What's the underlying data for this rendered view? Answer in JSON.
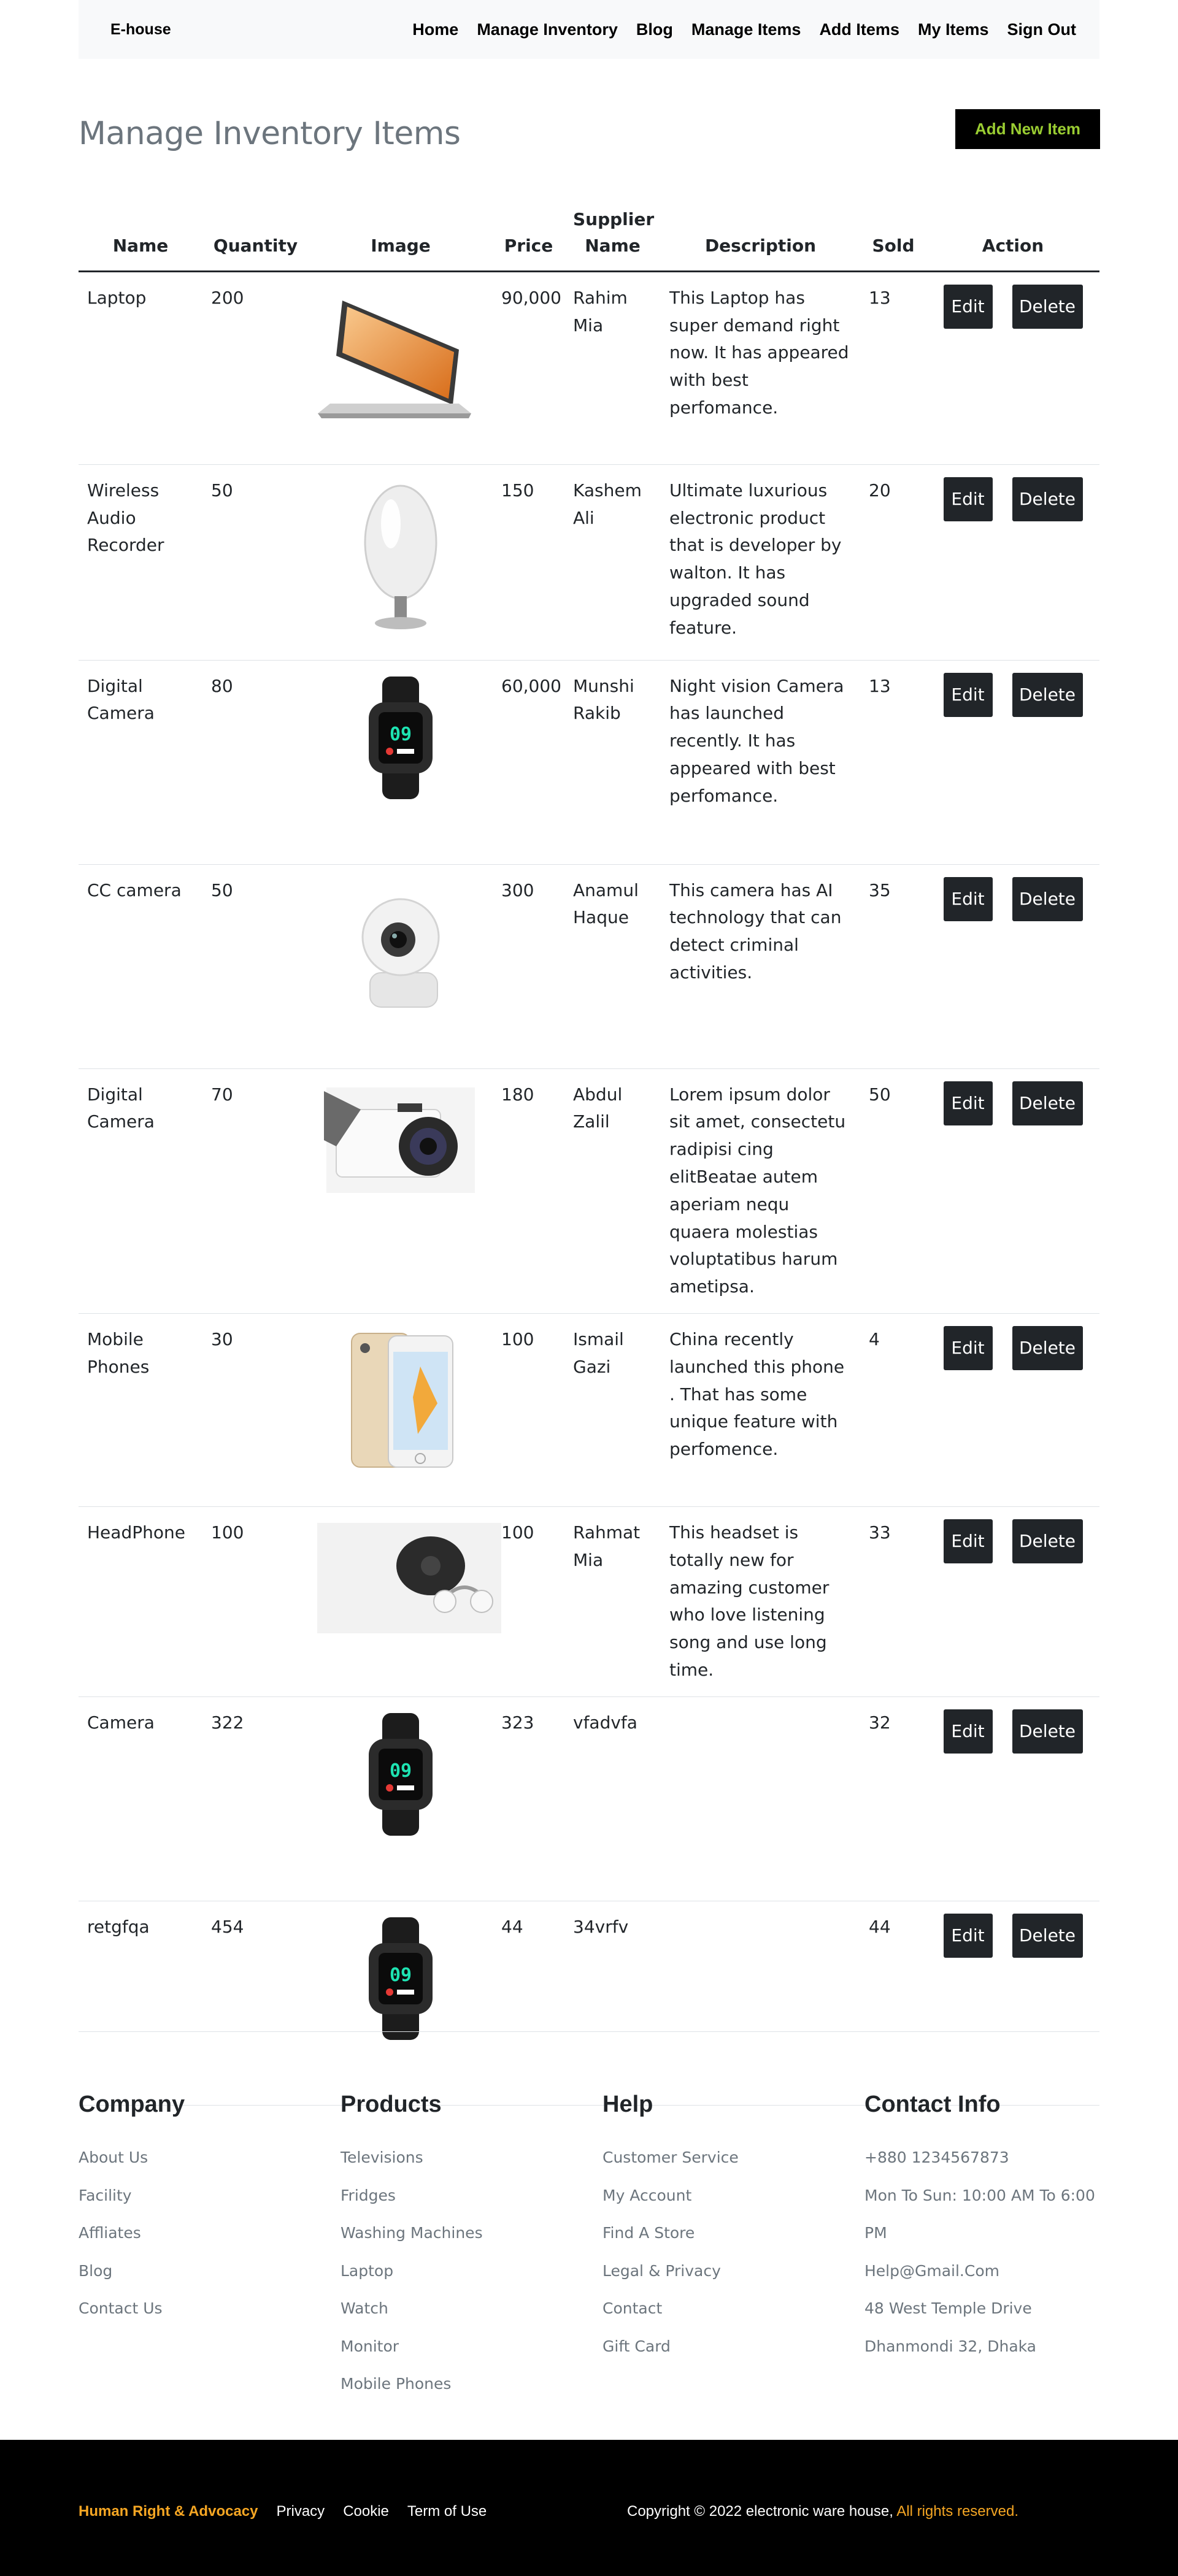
{
  "nav": {
    "brand": "E-house",
    "links": [
      "Home",
      "Manage Inventory",
      "Blog",
      "Manage Items",
      "Add Items",
      "My Items",
      "Sign Out"
    ]
  },
  "page": {
    "title": "Manage Inventory Items",
    "add_button": "Add New Item"
  },
  "table": {
    "headers": {
      "name": "Name",
      "quantity": "Quantity",
      "image": "Image",
      "price": "Price",
      "supplier": "Supplier Name",
      "description": "Description",
      "sold": "Sold",
      "action": "Action"
    },
    "edit_label": "Edit",
    "delete_label": "Delete",
    "rows": [
      {
        "name": "Laptop",
        "quantity": "200",
        "image": "laptop-image",
        "price": "90,000",
        "supplier": "Rahim Mia",
        "description": "This Laptop has super demand right now. It has appeared with best perfomance.",
        "sold": "13"
      },
      {
        "name": "Wireless Audio Recorder",
        "quantity": "50",
        "image": "speaker-image",
        "price": "150",
        "supplier": "Kashem Ali",
        "description": "Ultimate luxurious electronic product that is developer by walton. It has upgraded sound feature.",
        "sold": "20"
      },
      {
        "name": "Digital Camera",
        "quantity": "80",
        "image": "smartwatch-image",
        "price": "60,000",
        "supplier": "Munshi Rakib",
        "description": "Night vision Camera has launched recently. It has appeared with best perfomance.",
        "sold": "13"
      },
      {
        "name": "CC camera",
        "quantity": "50",
        "image": "cctv-camera-image",
        "price": "300",
        "supplier": "Anamul Haque",
        "description": "This camera has AI technology that can detect criminal activities.",
        "sold": "35"
      },
      {
        "name": "Digital Camera",
        "quantity": "70",
        "image": "digital-camera-image",
        "price": "180",
        "supplier": "Abdul Zalil",
        "description": "Lorem ipsum dolor sit amet, consectetu radipisi cing elitBeatae autem aperiam nequ quaera molestias voluptatibus harum ametipsa.",
        "sold": "50"
      },
      {
        "name": "Mobile Phones",
        "quantity": "30",
        "image": "phone-image",
        "price": "100",
        "supplier": "Ismail Gazi",
        "description": "China recently launched this phone . That has some unique feature with perfomence.",
        "sold": "4"
      },
      {
        "name": "HeadPhone",
        "quantity": "100",
        "image": "headphone-image",
        "price": "100",
        "supplier": "Rahmat Mia",
        "description": "This headset is totally new for amazing customer who love listening song and use long time.",
        "sold": "33"
      },
      {
        "name": "Camera",
        "quantity": "322",
        "image": "smartwatch-image",
        "price": "323",
        "supplier": "vfadvfa",
        "description": "",
        "sold": "32"
      },
      {
        "name": "retgfqa",
        "quantity": "454",
        "image": "smartwatch-image",
        "price": "44",
        "supplier": "34vrfv",
        "description": "",
        "sold": "44"
      }
    ]
  },
  "watch_screen": {
    "time": "09"
  },
  "footer": {
    "company": {
      "title": "Company",
      "links": [
        "About Us",
        "Facility",
        "Affliates",
        "Blog",
        "Contact Us"
      ]
    },
    "products": {
      "title": "Products",
      "links": [
        "Televisions",
        "Fridges",
        "Washing Machines",
        "Laptop",
        "Watch",
        "Monitor",
        "Mobile Phones"
      ]
    },
    "help": {
      "title": "Help",
      "links": [
        "Customer Service",
        "My Account",
        "Find A Store",
        "Legal & Privacy",
        "Contact",
        "Gift Card"
      ]
    },
    "contact": {
      "title": "Contact Info",
      "items": [
        "+880 1234567873",
        "Mon To Sun: 10:00 AM To 6:00",
        "PM",
        "Help@Gmail.Com",
        "48 West Temple Drive",
        "Dhanmondi 32, Dhaka"
      ]
    }
  },
  "bottom": {
    "brand": "Human Right & Advocacy",
    "links": [
      "Privacy",
      "Cookie",
      "Term of Use"
    ],
    "copyright": "Copyright © 2022 electronic ware house,",
    "rights": "All rights reserved."
  },
  "colors": {
    "accent": "#9acd32",
    "footer_accent": "#f5a623",
    "dark": "#212529"
  }
}
